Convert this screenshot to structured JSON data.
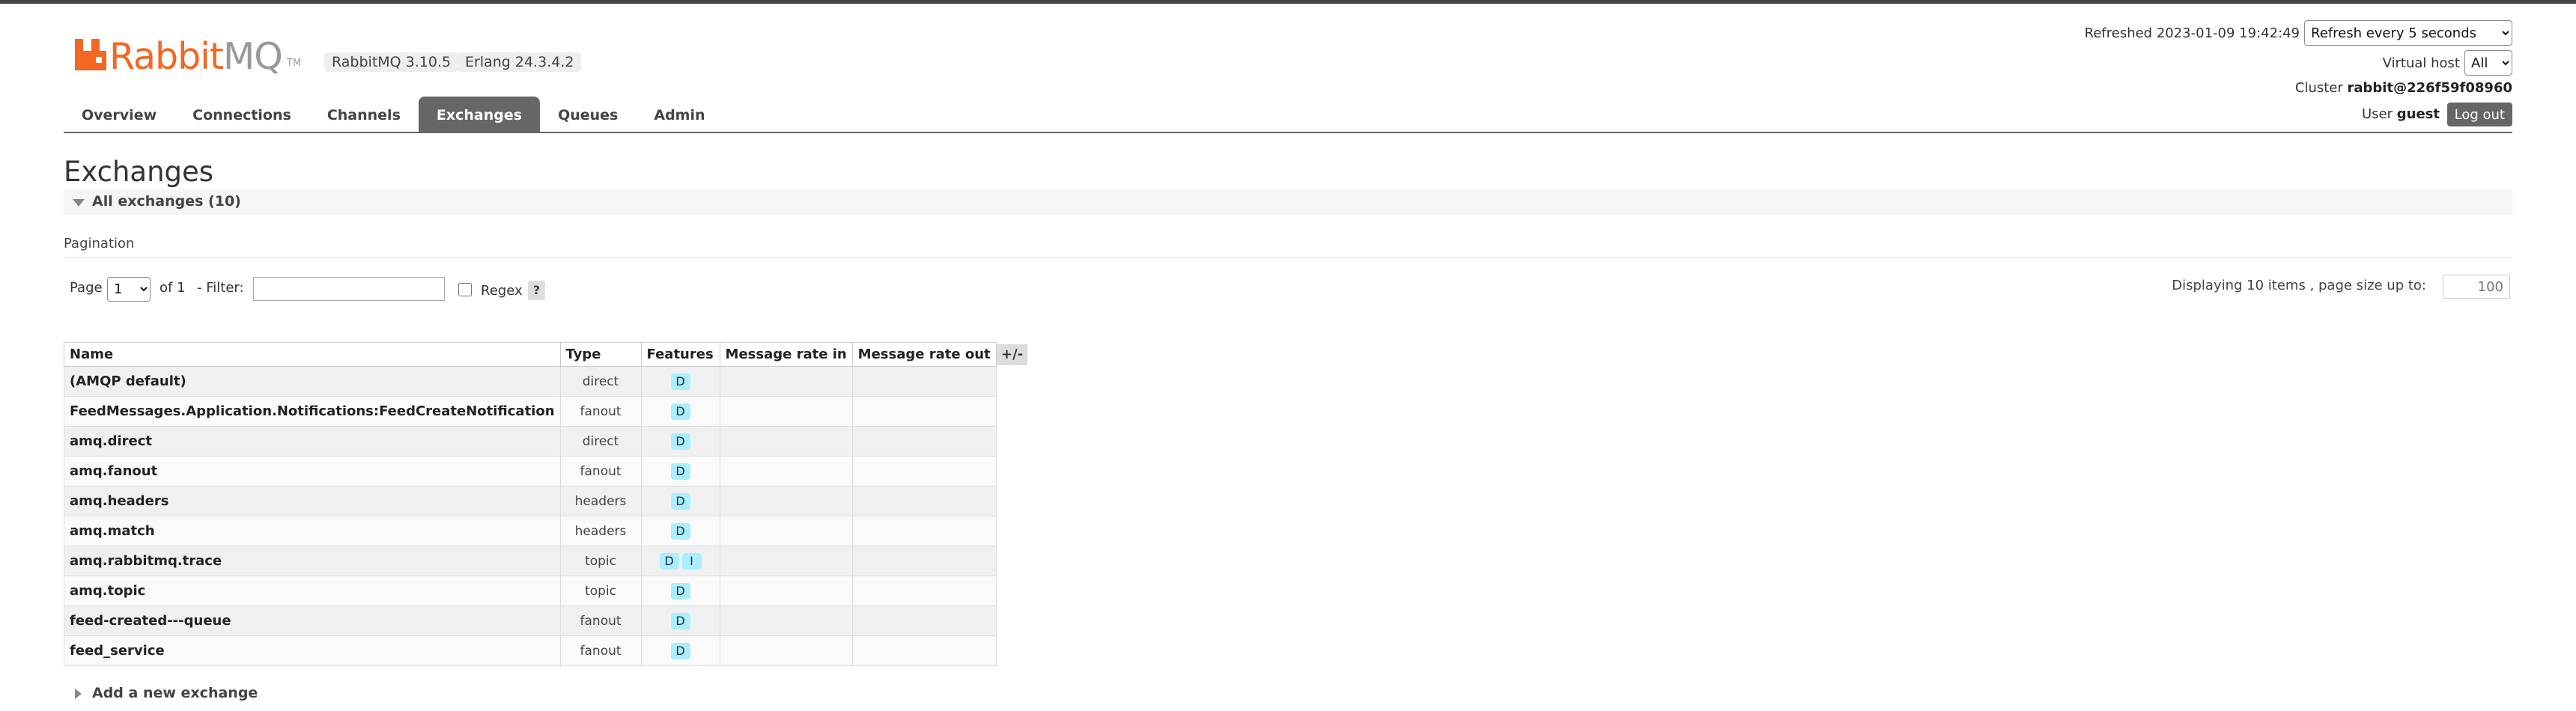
{
  "header": {
    "logo_main": "Rabbit",
    "logo_suffix": "MQ",
    "logo_tm": "TM",
    "rabbitmq_version": "RabbitMQ 3.10.5",
    "erlang_version": "Erlang 24.3.4.2",
    "brand_color": "#f26722"
  },
  "status": {
    "refreshed_label": "Refreshed 2023-01-09 19:42:49",
    "refresh_option": "Refresh every 5 seconds",
    "vhost_label": "Virtual host",
    "vhost_option": "All",
    "cluster_label": "Cluster",
    "cluster_name": "rabbit@226f59f08960",
    "user_label": "User",
    "user_name": "guest",
    "logout_label": "Log out"
  },
  "tabs": [
    {
      "label": "Overview",
      "active": false
    },
    {
      "label": "Connections",
      "active": false
    },
    {
      "label": "Channels",
      "active": false
    },
    {
      "label": "Exchanges",
      "active": true
    },
    {
      "label": "Queues",
      "active": false
    },
    {
      "label": "Admin",
      "active": false
    }
  ],
  "page": {
    "title": "Exchanges",
    "section_label": "All exchanges (10)",
    "pagination_label": "Pagination",
    "page_label": "Page",
    "page_value": "1",
    "of_label": "of 1",
    "filter_label": "- Filter:",
    "filter_value": "",
    "regex_label": "Regex",
    "help_label": "?",
    "display_info": "Displaying 10 items , page size up to:",
    "page_size": "100",
    "add_exchange_label": "Add a new exchange"
  },
  "table": {
    "columns": [
      "Name",
      "Type",
      "Features",
      "Message rate in",
      "Message rate out"
    ],
    "toggle_label": "+/-",
    "rows": [
      {
        "name": "(AMQP default)",
        "type": "direct",
        "features": [
          "D"
        ],
        "rate_in": "",
        "rate_out": ""
      },
      {
        "name": "FeedMessages.Application.Notifications:FeedCreateNotification",
        "type": "fanout",
        "features": [
          "D"
        ],
        "rate_in": "",
        "rate_out": ""
      },
      {
        "name": "amq.direct",
        "type": "direct",
        "features": [
          "D"
        ],
        "rate_in": "",
        "rate_out": ""
      },
      {
        "name": "amq.fanout",
        "type": "fanout",
        "features": [
          "D"
        ],
        "rate_in": "",
        "rate_out": ""
      },
      {
        "name": "amq.headers",
        "type": "headers",
        "features": [
          "D"
        ],
        "rate_in": "",
        "rate_out": ""
      },
      {
        "name": "amq.match",
        "type": "headers",
        "features": [
          "D"
        ],
        "rate_in": "",
        "rate_out": ""
      },
      {
        "name": "amq.rabbitmq.trace",
        "type": "topic",
        "features": [
          "D",
          "I"
        ],
        "rate_in": "",
        "rate_out": ""
      },
      {
        "name": "amq.topic",
        "type": "topic",
        "features": [
          "D"
        ],
        "rate_in": "",
        "rate_out": ""
      },
      {
        "name": "feed-created---queue",
        "type": "fanout",
        "features": [
          "D"
        ],
        "rate_in": "",
        "rate_out": ""
      },
      {
        "name": "feed_service",
        "type": "fanout",
        "features": [
          "D"
        ],
        "rate_in": "",
        "rate_out": ""
      }
    ]
  }
}
